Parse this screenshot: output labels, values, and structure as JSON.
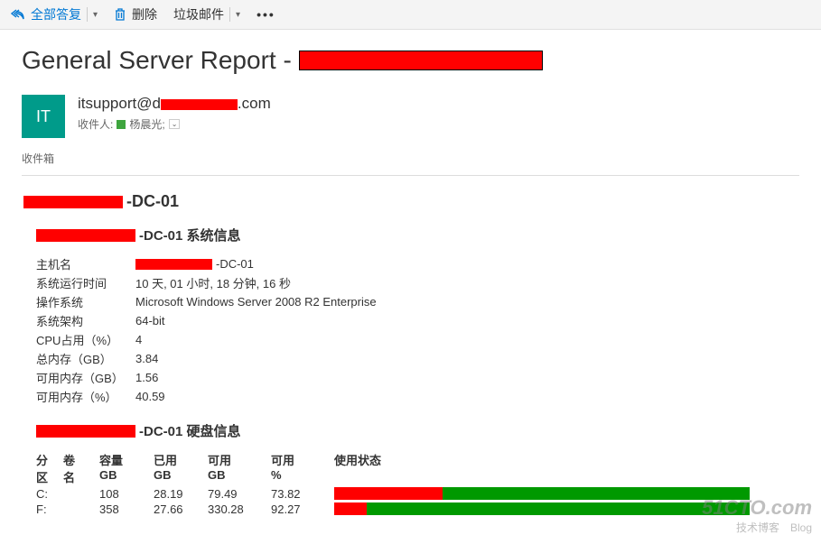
{
  "toolbar": {
    "reply_all": "全部答复",
    "delete": "删除",
    "junk": "垃圾邮件"
  },
  "subject_prefix": "General Server Report - ",
  "avatar_initials": "IT",
  "sender_email_prefix": "itsupport@d",
  "sender_email_suffix": ".com",
  "recipients_label": "收件人:",
  "recipient_name": "杨晨光;",
  "folder": "收件箱",
  "host_suffix": "-DC-01",
  "sysinfo_suffix": "-DC-01 系统信息",
  "diskinfo_suffix": "-DC-01 硬盘信息",
  "sys": {
    "hostname_label": "主机名",
    "hostname_suffix": "-DC-01",
    "uptime_label": "系统运行时间",
    "uptime_value": "10 天, 01 小时, 18 分钟, 16 秒",
    "os_label": "操作系统",
    "os_value": "Microsoft Windows Server 2008 R2 Enterprise",
    "arch_label": "系统架构",
    "arch_value": "64-bit",
    "cpu_label": "CPU占用（%）",
    "cpu_value": "4",
    "totalmem_label": "总内存（GB）",
    "totalmem_value": "3.84",
    "availmem_label": "可用内存（GB）",
    "availmem_value": "1.56",
    "availmempct_label": "可用内存（%）",
    "availmempct_value": "40.59"
  },
  "disk": {
    "h_part1": "分",
    "h_part2": "区",
    "h_vol1": "卷",
    "h_vol2": "名",
    "h_cap1": "容量",
    "h_cap2": "GB",
    "h_used1": "已用",
    "h_used2": "GB",
    "h_avail1": "可用",
    "h_avail2": "GB",
    "h_pct1": "可用",
    "h_pct2": "%",
    "h_status": "使用状态",
    "rows": [
      {
        "part": "C:",
        "vol": "",
        "cap": "108",
        "used": "28.19",
        "avail": "79.49",
        "pct": "73.82",
        "used_w": 120,
        "free_w": 340
      },
      {
        "part": "F:",
        "vol": "",
        "cap": "358",
        "used": "27.66",
        "avail": "330.28",
        "pct": "92.27",
        "used_w": 36,
        "free_w": 424
      }
    ]
  },
  "watermark": {
    "big": "51CTO.com",
    "small": "技术博客　Blog"
  }
}
